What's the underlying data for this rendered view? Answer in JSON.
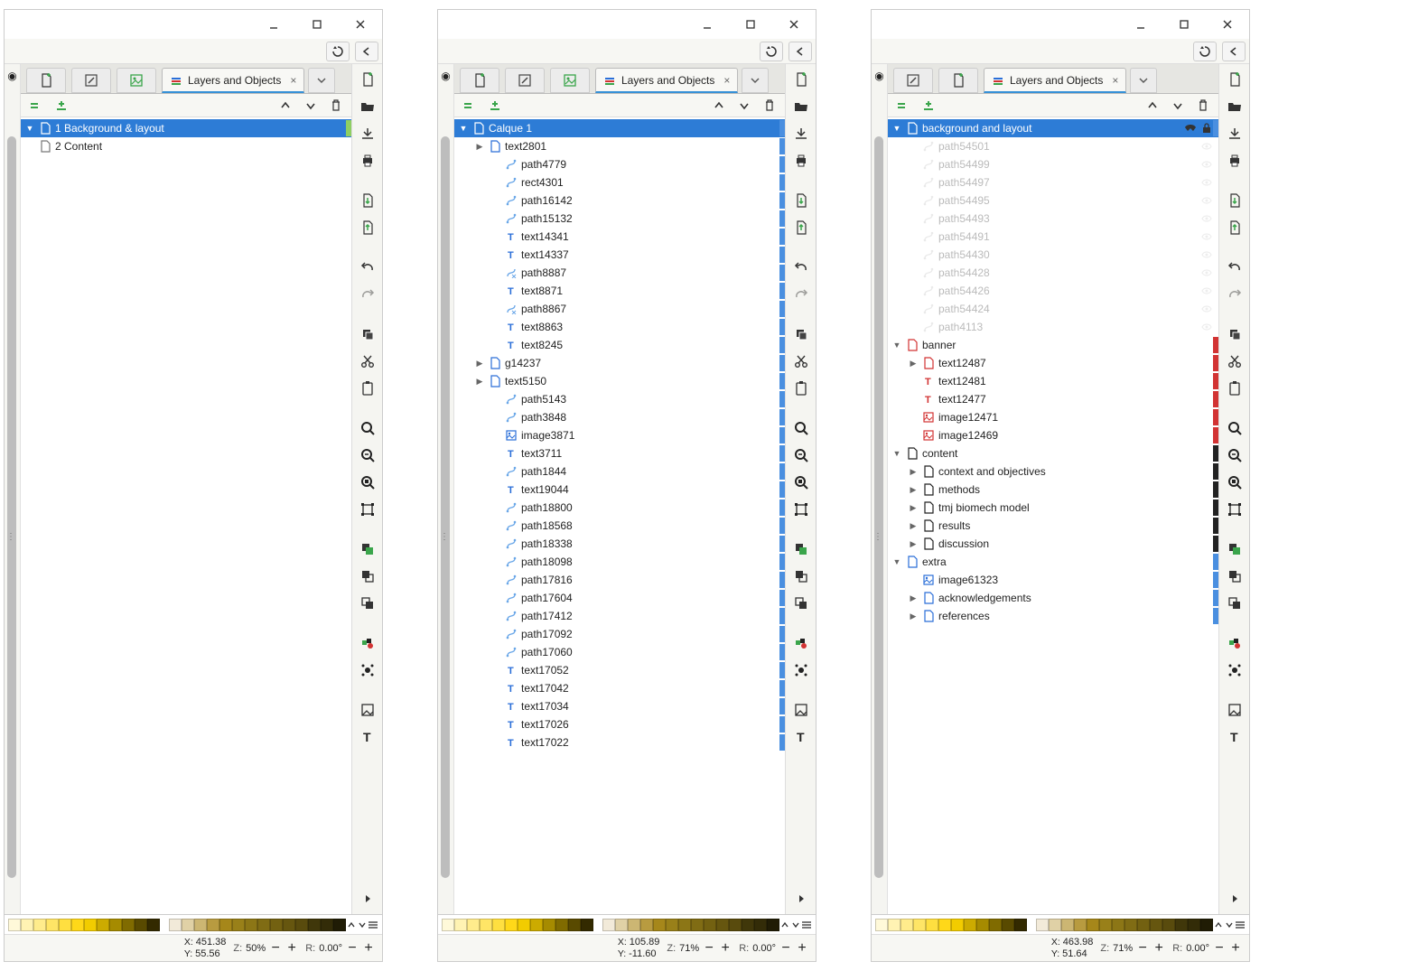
{
  "panelTitle": "Layers and Objects",
  "colors": {
    "selected": "#2d7cd6",
    "blue": "#2a6ed8",
    "red": "#d23333",
    "green": "#3aa54b",
    "black": "#222222",
    "dim": "#c4c4c4"
  },
  "windows": [
    {
      "tabButtons": [
        "new-doc",
        "edit",
        "image"
      ],
      "tree": [
        {
          "depth": 0,
          "expander": "down",
          "icon": "layer",
          "color": "#3aa54b",
          "label": "1 Background & layout",
          "selected": true,
          "strip": "#8fcf63"
        },
        {
          "depth": 0,
          "expander": "",
          "icon": "layer",
          "color": "#777",
          "label": "2 Content",
          "strip": "#ffffff"
        }
      ],
      "status": {
        "x": "451.38",
        "y": "55.56",
        "zoom": "50%",
        "rot": "0.00°"
      }
    },
    {
      "tabButtons": [
        "new-doc",
        "edit",
        "image"
      ],
      "tree": [
        {
          "depth": 0,
          "expander": "down",
          "icon": "layer",
          "color": "#2a6ed8",
          "label": "Calque 1",
          "selected": true,
          "strip": "#4a8fe0"
        },
        {
          "depth": 1,
          "expander": "right",
          "icon": "layer",
          "color": "#2a6ed8",
          "label": "text2801",
          "strip": "#4a8fe0"
        },
        {
          "depth": 2,
          "expander": "",
          "icon": "path",
          "color": "#6aa7e8",
          "label": "path4779",
          "strip": "#4a8fe0"
        },
        {
          "depth": 2,
          "expander": "",
          "icon": "path",
          "color": "#6aa7e8",
          "label": "rect4301",
          "strip": "#4a8fe0"
        },
        {
          "depth": 2,
          "expander": "",
          "icon": "path",
          "color": "#6aa7e8",
          "label": "path16142",
          "strip": "#4a8fe0"
        },
        {
          "depth": 2,
          "expander": "",
          "icon": "path",
          "color": "#6aa7e8",
          "label": "path15132",
          "strip": "#4a8fe0"
        },
        {
          "depth": 2,
          "expander": "",
          "icon": "text",
          "color": "#2a6ed8",
          "label": "text14341",
          "strip": "#4a8fe0"
        },
        {
          "depth": 2,
          "expander": "",
          "icon": "text",
          "color": "#2a6ed8",
          "label": "text14337",
          "strip": "#4a8fe0"
        },
        {
          "depth": 2,
          "expander": "",
          "icon": "pathx",
          "color": "#6aa7e8",
          "label": "path8887",
          "strip": "#4a8fe0"
        },
        {
          "depth": 2,
          "expander": "",
          "icon": "text",
          "color": "#2a6ed8",
          "label": "text8871",
          "strip": "#4a8fe0"
        },
        {
          "depth": 2,
          "expander": "",
          "icon": "pathx",
          "color": "#6aa7e8",
          "label": "path8867",
          "strip": "#4a8fe0"
        },
        {
          "depth": 2,
          "expander": "",
          "icon": "text",
          "color": "#2a6ed8",
          "label": "text8863",
          "strip": "#4a8fe0"
        },
        {
          "depth": 2,
          "expander": "",
          "icon": "text",
          "color": "#2a6ed8",
          "label": "text8245",
          "strip": "#4a8fe0"
        },
        {
          "depth": 1,
          "expander": "right",
          "icon": "layer",
          "color": "#2a6ed8",
          "label": "g14237",
          "strip": "#4a8fe0"
        },
        {
          "depth": 1,
          "expander": "right",
          "icon": "layer",
          "color": "#2a6ed8",
          "label": "text5150",
          "strip": "#4a8fe0"
        },
        {
          "depth": 2,
          "expander": "",
          "icon": "path",
          "color": "#6aa7e8",
          "label": "path5143",
          "strip": "#4a8fe0"
        },
        {
          "depth": 2,
          "expander": "",
          "icon": "path",
          "color": "#6aa7e8",
          "label": "path3848",
          "strip": "#4a8fe0"
        },
        {
          "depth": 2,
          "expander": "",
          "icon": "image",
          "color": "#2a6ed8",
          "label": "image3871",
          "strip": "#4a8fe0"
        },
        {
          "depth": 2,
          "expander": "",
          "icon": "text",
          "color": "#2a6ed8",
          "label": "text3711",
          "strip": "#4a8fe0"
        },
        {
          "depth": 2,
          "expander": "",
          "icon": "path",
          "color": "#6aa7e8",
          "label": "path1844",
          "strip": "#4a8fe0"
        },
        {
          "depth": 2,
          "expander": "",
          "icon": "text",
          "color": "#2a6ed8",
          "label": "text19044",
          "strip": "#4a8fe0"
        },
        {
          "depth": 2,
          "expander": "",
          "icon": "path",
          "color": "#6aa7e8",
          "label": "path18800",
          "strip": "#4a8fe0"
        },
        {
          "depth": 2,
          "expander": "",
          "icon": "path",
          "color": "#6aa7e8",
          "label": "path18568",
          "strip": "#4a8fe0"
        },
        {
          "depth": 2,
          "expander": "",
          "icon": "path",
          "color": "#6aa7e8",
          "label": "path18338",
          "strip": "#4a8fe0"
        },
        {
          "depth": 2,
          "expander": "",
          "icon": "path",
          "color": "#6aa7e8",
          "label": "path18098",
          "strip": "#4a8fe0"
        },
        {
          "depth": 2,
          "expander": "",
          "icon": "path",
          "color": "#6aa7e8",
          "label": "path17816",
          "strip": "#4a8fe0"
        },
        {
          "depth": 2,
          "expander": "",
          "icon": "path",
          "color": "#6aa7e8",
          "label": "path17604",
          "strip": "#4a8fe0"
        },
        {
          "depth": 2,
          "expander": "",
          "icon": "path",
          "color": "#6aa7e8",
          "label": "path17412",
          "strip": "#4a8fe0"
        },
        {
          "depth": 2,
          "expander": "",
          "icon": "path",
          "color": "#6aa7e8",
          "label": "path17092",
          "strip": "#4a8fe0"
        },
        {
          "depth": 2,
          "expander": "",
          "icon": "path",
          "color": "#6aa7e8",
          "label": "path17060",
          "strip": "#4a8fe0"
        },
        {
          "depth": 2,
          "expander": "",
          "icon": "text",
          "color": "#2a6ed8",
          "label": "text17052",
          "strip": "#4a8fe0"
        },
        {
          "depth": 2,
          "expander": "",
          "icon": "text",
          "color": "#2a6ed8",
          "label": "text17042",
          "strip": "#4a8fe0"
        },
        {
          "depth": 2,
          "expander": "",
          "icon": "text",
          "color": "#2a6ed8",
          "label": "text17034",
          "strip": "#4a8fe0"
        },
        {
          "depth": 2,
          "expander": "",
          "icon": "text",
          "color": "#2a6ed8",
          "label": "text17026",
          "strip": "#4a8fe0"
        },
        {
          "depth": 2,
          "expander": "",
          "icon": "text",
          "color": "#2a6ed8",
          "label": "text17022",
          "strip": "#4a8fe0"
        }
      ],
      "status": {
        "x": "105.89",
        "y": "-11.60",
        "zoom": "71%",
        "rot": "0.00°"
      }
    },
    {
      "tabButtons": [
        "edit",
        "new-doc"
      ],
      "tree": [
        {
          "depth": 0,
          "expander": "down",
          "icon": "layer",
          "color": "#2a6ed8",
          "label": "background and layout",
          "selected": true,
          "lock": true,
          "strip": "#4a8fe0"
        },
        {
          "depth": 1,
          "expander": "",
          "icon": "path",
          "color": "#c4c4c4",
          "label": "path54501",
          "dim": true,
          "status": "eye"
        },
        {
          "depth": 1,
          "expander": "",
          "icon": "path",
          "color": "#c4c4c4",
          "label": "path54499",
          "dim": true,
          "status": "eye"
        },
        {
          "depth": 1,
          "expander": "",
          "icon": "path",
          "color": "#c4c4c4",
          "label": "path54497",
          "dim": true,
          "status": "eye"
        },
        {
          "depth": 1,
          "expander": "",
          "icon": "path",
          "color": "#c4c4c4",
          "label": "path54495",
          "dim": true,
          "status": "eye"
        },
        {
          "depth": 1,
          "expander": "",
          "icon": "path",
          "color": "#c4c4c4",
          "label": "path54493",
          "dim": true,
          "status": "eye"
        },
        {
          "depth": 1,
          "expander": "",
          "icon": "path",
          "color": "#c4c4c4",
          "label": "path54491",
          "dim": true,
          "status": "eye"
        },
        {
          "depth": 1,
          "expander": "",
          "icon": "path",
          "color": "#c4c4c4",
          "label": "path54430",
          "dim": true,
          "status": "eye"
        },
        {
          "depth": 1,
          "expander": "",
          "icon": "path",
          "color": "#c4c4c4",
          "label": "path54428",
          "dim": true,
          "status": "eye"
        },
        {
          "depth": 1,
          "expander": "",
          "icon": "path",
          "color": "#c4c4c4",
          "label": "path54426",
          "dim": true,
          "status": "eye"
        },
        {
          "depth": 1,
          "expander": "",
          "icon": "path",
          "color": "#c4c4c4",
          "label": "path54424",
          "dim": true,
          "status": "eye"
        },
        {
          "depth": 1,
          "expander": "",
          "icon": "path",
          "color": "#c4c4c4",
          "label": "path4113",
          "dim": true,
          "status": "eye"
        },
        {
          "depth": 0,
          "expander": "down",
          "icon": "layer",
          "color": "#d23333",
          "label": "banner",
          "strip": "#d23333"
        },
        {
          "depth": 1,
          "expander": "right",
          "icon": "layer",
          "color": "#d23333",
          "label": "text12487",
          "strip": "#d23333"
        },
        {
          "depth": 1,
          "expander": "",
          "icon": "text",
          "color": "#d23333",
          "label": "text12481",
          "strip": "#d23333"
        },
        {
          "depth": 1,
          "expander": "",
          "icon": "text",
          "color": "#d23333",
          "label": "text12477",
          "strip": "#d23333"
        },
        {
          "depth": 1,
          "expander": "",
          "icon": "image",
          "color": "#d23333",
          "label": "image12471",
          "strip": "#d23333"
        },
        {
          "depth": 1,
          "expander": "",
          "icon": "image",
          "color": "#d23333",
          "label": "image12469",
          "strip": "#d23333"
        },
        {
          "depth": 0,
          "expander": "down",
          "icon": "layer",
          "color": "#222",
          "label": "content",
          "strip": "#222"
        },
        {
          "depth": 1,
          "expander": "right",
          "icon": "layer",
          "color": "#222",
          "label": "context and objectives",
          "strip": "#222"
        },
        {
          "depth": 1,
          "expander": "right",
          "icon": "layer",
          "color": "#222",
          "label": "methods",
          "strip": "#222"
        },
        {
          "depth": 1,
          "expander": "right",
          "icon": "layer",
          "color": "#222",
          "label": "tmj biomech model",
          "strip": "#222"
        },
        {
          "depth": 1,
          "expander": "right",
          "icon": "layer",
          "color": "#222",
          "label": "results",
          "strip": "#222"
        },
        {
          "depth": 1,
          "expander": "right",
          "icon": "layer",
          "color": "#222",
          "label": "discussion",
          "strip": "#222"
        },
        {
          "depth": 0,
          "expander": "down",
          "icon": "layer",
          "color": "#2a6ed8",
          "label": "extra",
          "strip": "#4a8fe0"
        },
        {
          "depth": 1,
          "expander": "",
          "icon": "image",
          "color": "#2a6ed8",
          "label": "image61323",
          "strip": "#4a8fe0"
        },
        {
          "depth": 1,
          "expander": "right",
          "icon": "layer",
          "color": "#2a6ed8",
          "label": "acknowledgements",
          "strip": "#4a8fe0"
        },
        {
          "depth": 1,
          "expander": "right",
          "icon": "layer",
          "color": "#2a6ed8",
          "label": "references",
          "strip": "#4a8fe0"
        }
      ],
      "status": {
        "x": "463.98",
        "y": "51.64",
        "zoom": "71%",
        "rot": "0.00°"
      }
    }
  ],
  "palette1": [
    "#fff9d9",
    "#fff3b3",
    "#ffec8c",
    "#ffe566",
    "#ffdf40",
    "#ffd819",
    "#f2cc00",
    "#ccab00",
    "#a68b00",
    "#806b00",
    "#594a00",
    "#332a00"
  ],
  "palette2": [
    "#f2ead9",
    "#e0d1a6",
    "#ccb673",
    "#b89b40",
    "#a6871a",
    "#998019",
    "#8c7616",
    "#806c14",
    "#736111",
    "#66560f",
    "#594b0d",
    "#40370a",
    "#332c08",
    "#201c05"
  ],
  "labels": {
    "X": "X:",
    "Y": "Y:",
    "Z": "Z:",
    "R": "R:"
  }
}
